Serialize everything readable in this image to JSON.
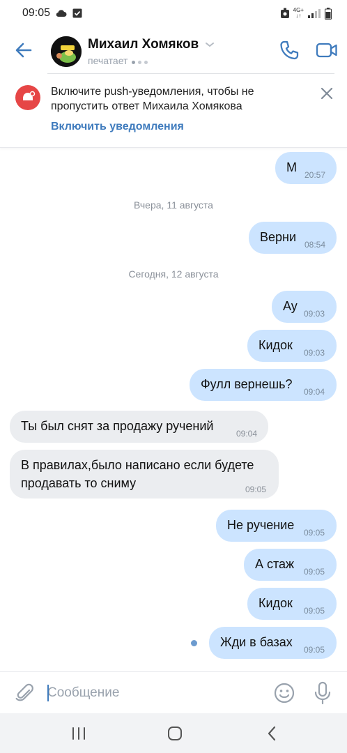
{
  "status_bar": {
    "time": "09:05",
    "network": "4G+"
  },
  "header": {
    "contact_name": "Михаил Хомяков",
    "status": "печатает",
    "icons": [
      "back-arrow-icon",
      "chevron-down-icon",
      "phone-icon",
      "video-camera-icon"
    ]
  },
  "banner": {
    "text": "Включите push-уведомления, чтобы не пропустить ответ Михаила Хомякова",
    "link": "Включить уведомления"
  },
  "messages": [
    {
      "direction": "out",
      "text": "М",
      "time": "20:57"
    },
    {
      "type": "date",
      "text": "Вчера, 11 августа"
    },
    {
      "direction": "out",
      "text": "Верни",
      "time": "08:54"
    },
    {
      "type": "date",
      "text": "Сегодня, 12 августа"
    },
    {
      "direction": "out",
      "text": "Ау",
      "time": "09:03"
    },
    {
      "direction": "out",
      "text": "Кидок",
      "time": "09:03"
    },
    {
      "direction": "out",
      "text": "Фулл вернешь?",
      "time": "09:04"
    },
    {
      "direction": "in",
      "text": "Ты был снят за продажу ручений",
      "time": "09:04"
    },
    {
      "direction": "in",
      "text_line1": "В правилах,было написано если будете",
      "text_line2": "продавать то сниму",
      "time": "09:05"
    },
    {
      "direction": "out",
      "text": "Не ручение",
      "time": "09:05"
    },
    {
      "direction": "out",
      "text": "А стаж",
      "time": "09:05"
    },
    {
      "direction": "out",
      "text": "Кидок",
      "time": "09:05"
    },
    {
      "direction": "out",
      "text": "Жди в базах",
      "time": "09:05",
      "unread": true
    }
  ],
  "input": {
    "placeholder": "Сообщение"
  },
  "colors": {
    "accent": "#3f7bbd",
    "outgoing_bubble": "#cce4ff",
    "incoming_bubble": "#ebedf0",
    "notification_badge": "#e64646"
  }
}
